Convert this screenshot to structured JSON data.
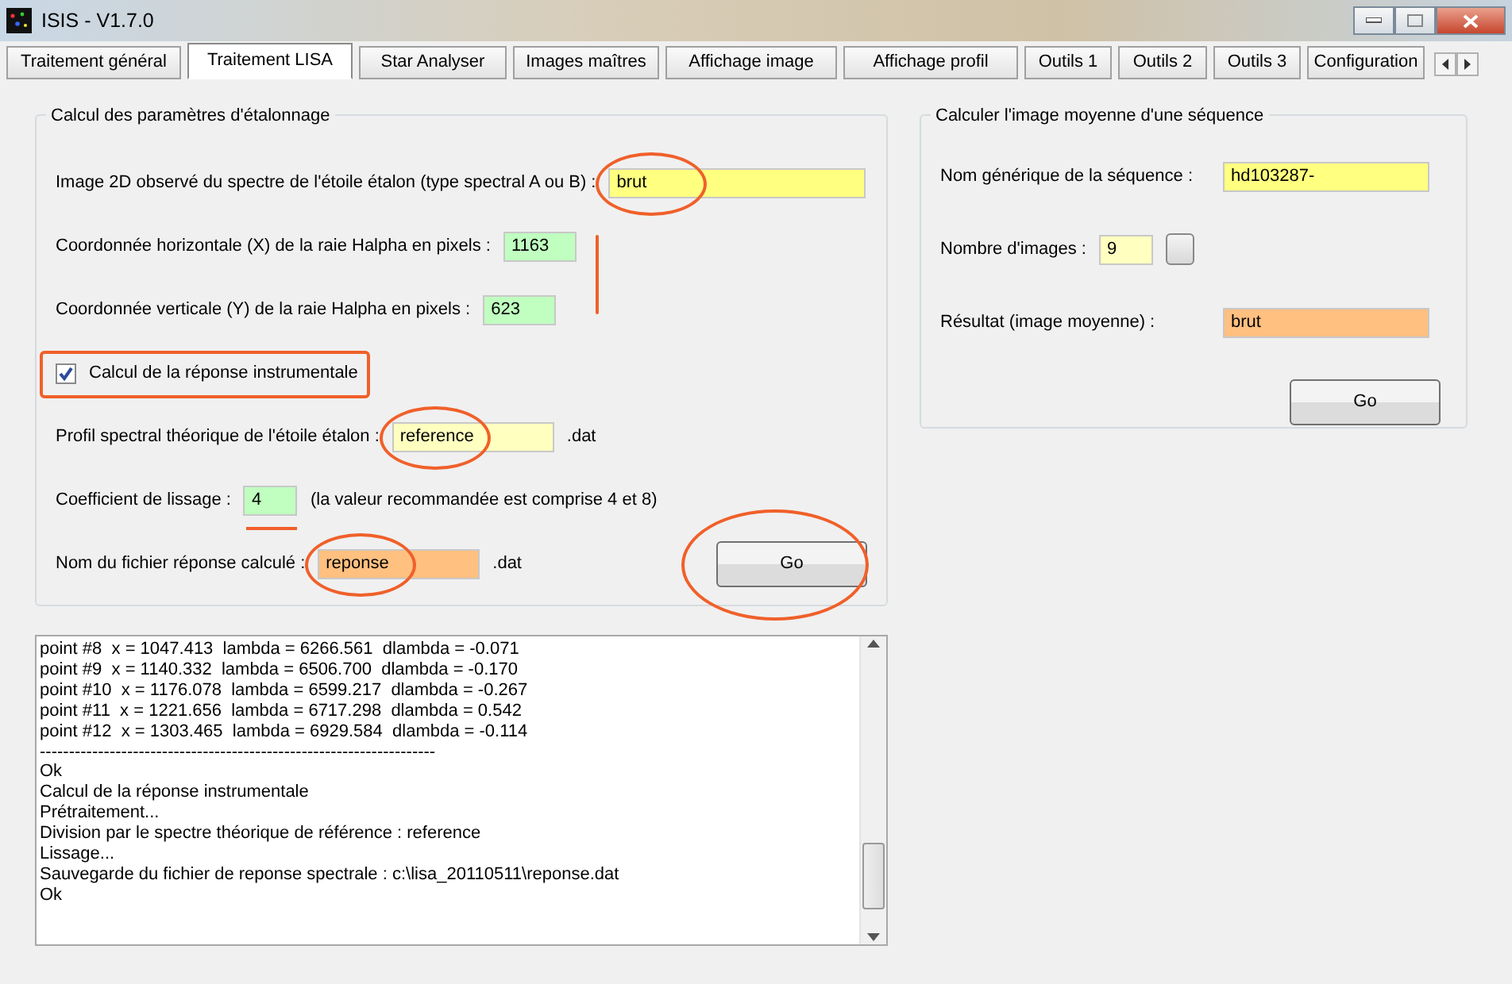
{
  "window": {
    "title": "ISIS - V1.7.0"
  },
  "tabs": [
    {
      "label": "Traitement général",
      "selected": false
    },
    {
      "label": "Traitement LISA",
      "selected": true
    },
    {
      "label": "Star Analyser",
      "selected": false
    },
    {
      "label": "Images maîtres",
      "selected": false
    },
    {
      "label": "Affichage image",
      "selected": false
    },
    {
      "label": "Affichage profil",
      "selected": false
    },
    {
      "label": "Outils 1",
      "selected": false
    },
    {
      "label": "Outils 2",
      "selected": false
    },
    {
      "label": "Outils 3",
      "selected": false
    },
    {
      "label": "Configuration",
      "selected": false
    }
  ],
  "calibration": {
    "title": "Calcul des paramètres d'étalonnage",
    "rows": [
      {
        "kind": "field",
        "label": "Image 2D observé du spectre de l'étoile étalon (type spectral A ou B) :",
        "value": "brut",
        "color": "#ffff80",
        "circled": true
      },
      {
        "kind": "field",
        "label": "Coordonnée horizontale (X) de la raie Halpha en pixels :",
        "value": "1163",
        "color": "#c0ffc0",
        "side_stroke": true
      },
      {
        "kind": "field",
        "label": "Coordonnée verticale (Y) de la raie Halpha en pixels :",
        "value": "623",
        "color": "#c0ffc0"
      },
      {
        "kind": "checkbox",
        "label": "Calcul de la réponse instrumentale",
        "checked": true,
        "boxed": true
      },
      {
        "kind": "field",
        "label": "Profil spectral théorique de l'étoile étalon :",
        "value": "reference",
        "color": "#ffffc0",
        "suffix": ".dat",
        "circled": true
      },
      {
        "kind": "field",
        "label": "Coefficient de lissage :",
        "value": "4",
        "color": "#c0ffc0",
        "suffix": "(la valeur recommandée est comprise 4 et 8)",
        "underlined": true
      },
      {
        "kind": "field",
        "label": "Nom du fichier réponse calculé :",
        "value": "reponse",
        "color": "#ffc080",
        "suffix": ".dat",
        "circled": true
      }
    ],
    "button": {
      "label": "Go",
      "circled": true
    }
  },
  "sequence": {
    "title": "Calculer l'image moyenne d'une séquence",
    "rows": [
      {
        "kind": "field",
        "label": "Nom générique de la séquence :",
        "value": "hd103287-",
        "color": "#ffff80"
      },
      {
        "kind": "spinner",
        "label": "Nombre d'images :",
        "value": "9",
        "color": "#ffffc0"
      },
      {
        "kind": "field",
        "label": "Résultat (image moyenne) :",
        "value": "brut",
        "color": "#ffc080"
      }
    ],
    "button": {
      "label": "Go"
    }
  },
  "log": {
    "lines": [
      "point #8  x = 1047.413  lambda = 6266.561  dlambda = -0.071",
      "point #9  x = 1140.332  lambda = 6506.700  dlambda = -0.170",
      "point #10  x = 1176.078  lambda = 6599.217  dlambda = -0.267",
      "point #11  x = 1221.656  lambda = 6717.298  dlambda = 0.542",
      "point #12  x = 1303.465  lambda = 6929.584  dlambda = -0.114",
      "--------------------------------------------------------------------",
      "Ok",
      "Calcul de la réponse instrumentale",
      "Prétraitement...",
      "Division par le spectre théorique de référence : reference",
      "Lissage...",
      "Sauvegarde du fichier de reponse spectrale : c:\\lisa_20110511\\reponse.dat",
      "Ok"
    ]
  }
}
